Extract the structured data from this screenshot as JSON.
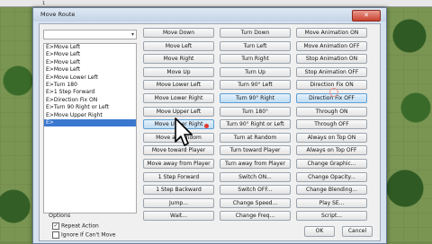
{
  "window": {
    "title": "Move Route",
    "close_glyph": "✕",
    "ruler_text": "1"
  },
  "char_select": {
    "value": ""
  },
  "command_list": [
    "E>Move Left",
    "E>Move Left",
    "E>Move Left",
    "E>Move Left",
    "E>Move Lower Left",
    "E>Turn 180",
    "E>1 Step Forward",
    "E>Direction Fix ON",
    "E>Turn 90 Right or Left",
    "E>Move Upper Right",
    "E>"
  ],
  "selected_index": 10,
  "options": {
    "label": "Options",
    "repeat_action": {
      "label": "Repeat Action",
      "checked": true
    },
    "ignore_cant_move": {
      "label": "Ignore If Can't Move",
      "checked": false
    }
  },
  "buttons": {
    "col1": [
      "Move Down",
      "Move Left",
      "Move Right",
      "Move Up",
      "Move Lower Left",
      "Move Lower Right",
      "Move Upper Left",
      "Move Upper Right",
      "Move at Random",
      "Move toward Player",
      "Move away from Player",
      "1 Step Forward",
      "1 Step Backward",
      "Jump...",
      "Wait..."
    ],
    "col2": [
      "Turn Down",
      "Turn Left",
      "Turn Right",
      "Turn Up",
      "Turn 90° Left",
      "Turn 90° Right",
      "Turn 180°",
      "Turn 90° Right or Left",
      "Turn at Random",
      "Turn toward Player",
      "Turn away from Player",
      "Switch ON...",
      "Switch OFF...",
      "Change Speed...",
      "Change Freq..."
    ],
    "col3": [
      "Move Animation ON",
      "Move Animation OFF",
      "Stop Animation ON",
      "Stop Animation OFF",
      "Direction Fix ON",
      "Direction Fix OFF",
      "Through ON",
      "Through OFF",
      "Always on Top ON",
      "Always on Top OFF",
      "Change Graphic...",
      "Change Opacity...",
      "Change Blending...",
      "Play SE...",
      "Script..."
    ],
    "ok": "OK",
    "cancel": "Cancel"
  },
  "icons": {
    "dropdown": "chevron-down-icon",
    "pointer": "mouse-pointer-icon"
  }
}
